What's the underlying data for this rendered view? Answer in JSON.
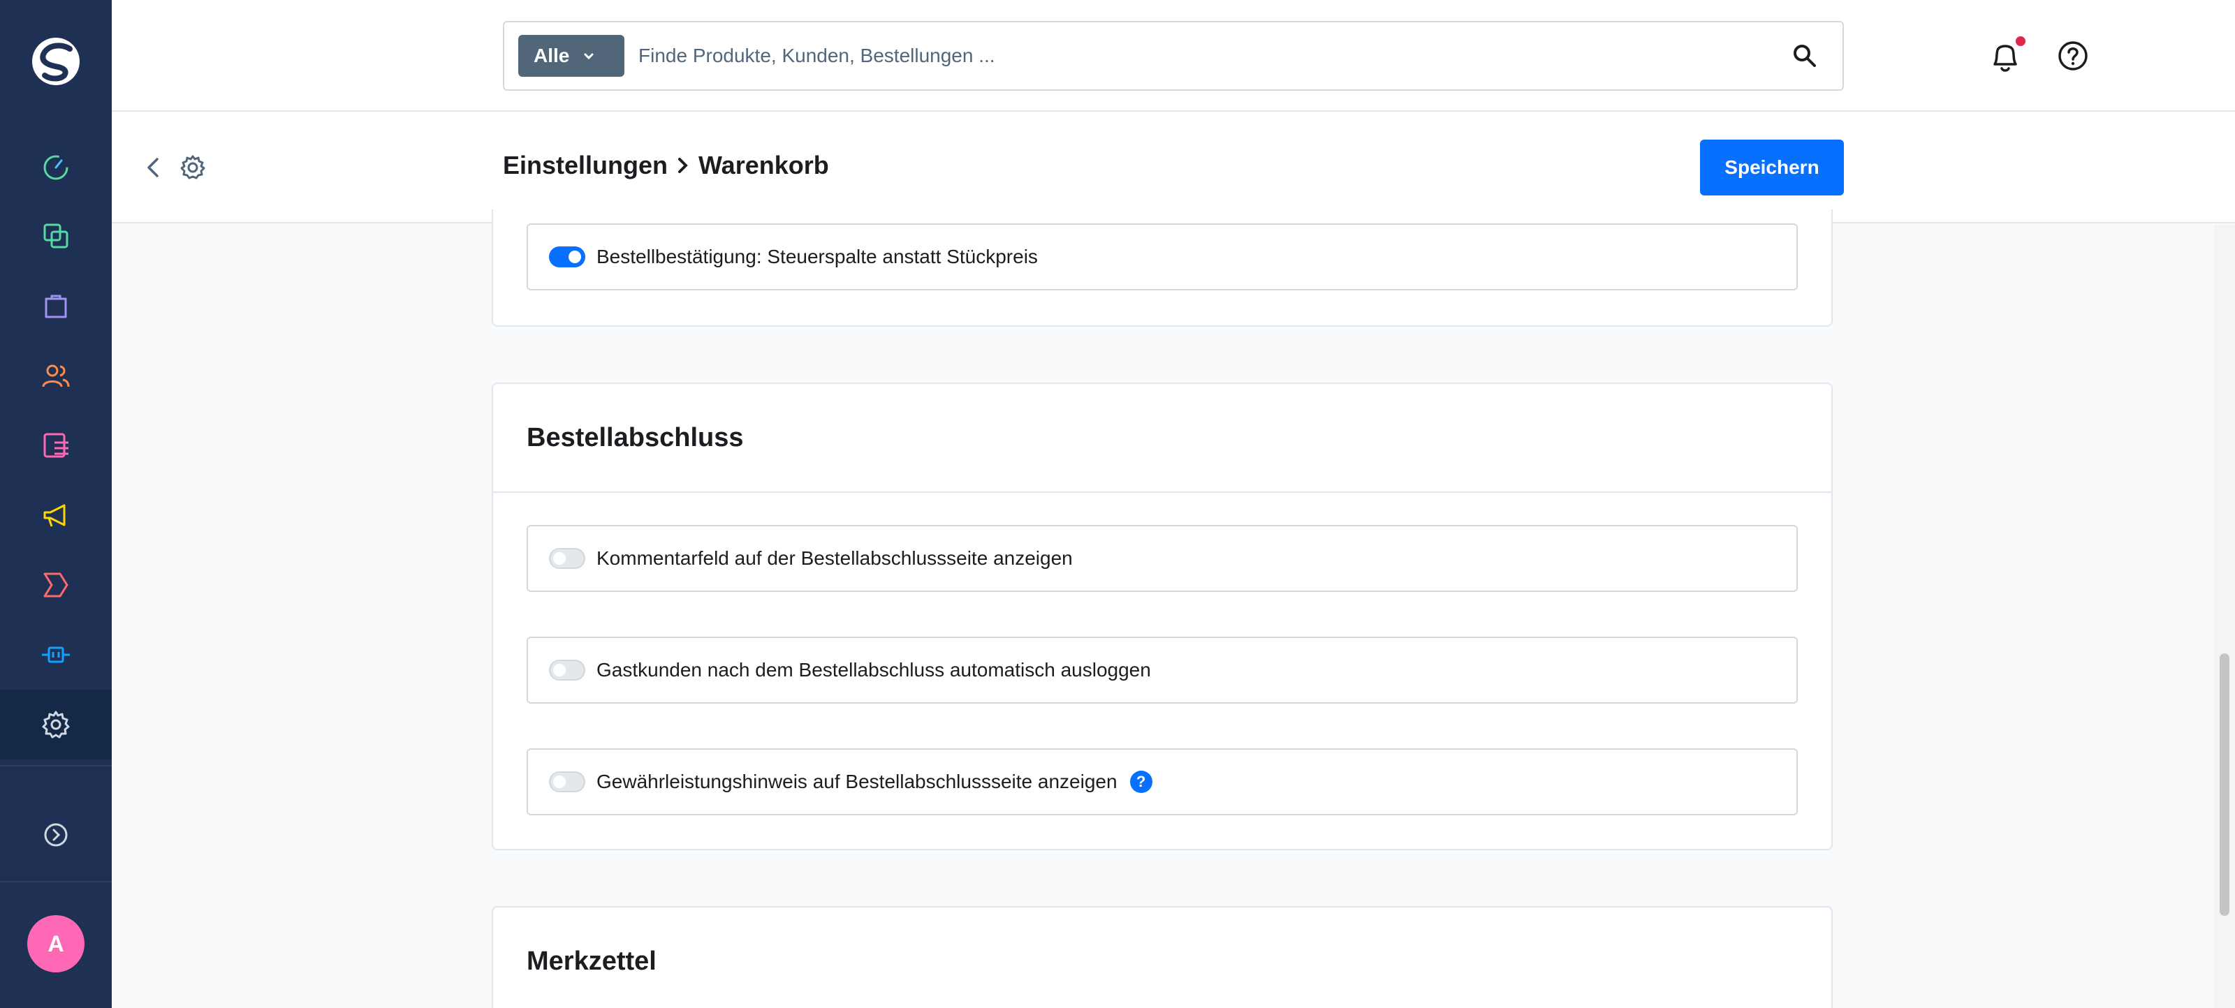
{
  "search": {
    "type_label": "Alle",
    "placeholder": "Finde Produkte, Kunden, Bestellungen ..."
  },
  "header": {
    "breadcrumb_parent": "Einstellungen",
    "breadcrumb_current": "Warenkorb",
    "save_label": "Speichern"
  },
  "user": {
    "avatar_initial": "A"
  },
  "sections": {
    "top": {
      "fields": [
        {
          "label": "Bestellbestätigung: Steuerspalte anstatt Stückpreis",
          "enabled": true
        }
      ]
    },
    "checkout": {
      "title": "Bestellabschluss",
      "fields": [
        {
          "label": "Kommentarfeld auf der Bestellabschlussseite anzeigen",
          "enabled": false
        },
        {
          "label": "Gastkunden nach dem Bestellabschluss automatisch ausloggen",
          "enabled": false
        },
        {
          "label": "Gewährleistungshinweis auf Bestellabschlussseite anzeigen",
          "enabled": false,
          "help": "?"
        }
      ]
    },
    "wishlist": {
      "title": "Merkzettel"
    }
  },
  "colors": {
    "sidebar": "#1e3154",
    "primary": "#0870ff",
    "avatar": "#ff68b4"
  }
}
